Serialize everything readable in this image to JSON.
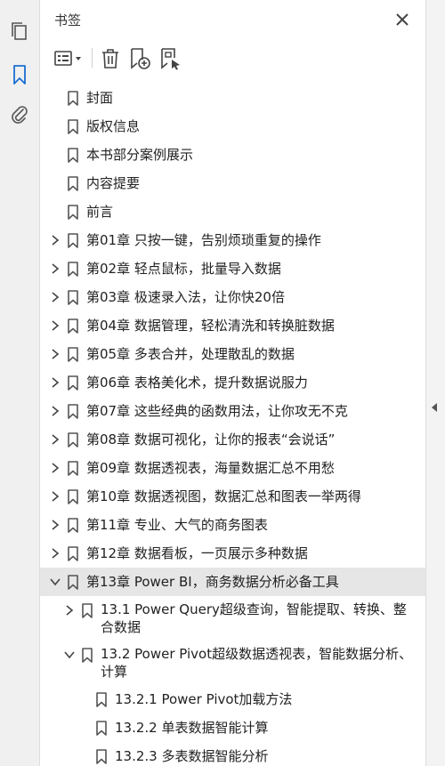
{
  "panel": {
    "title": "书签"
  },
  "colors": {
    "rail_bg": "#f0f0f0",
    "selected_bg": "#e6e6e6",
    "icon_active": "#1a6fd1",
    "icon_gray": "#555555"
  },
  "rail": {
    "icons": [
      "pages-icon",
      "bookmark-icon",
      "attachment-icon"
    ]
  },
  "toolbar": {
    "icons": [
      "options-menu-icon",
      "delete-bookmark-icon",
      "add-bookmark-icon",
      "new-bookmark-from-structure-icon"
    ]
  },
  "bookmarks": [
    {
      "label": "封面",
      "level": 0,
      "expandable": false
    },
    {
      "label": "版权信息",
      "level": 0,
      "expandable": false
    },
    {
      "label": "本书部分案例展示",
      "level": 0,
      "expandable": false
    },
    {
      "label": "内容提要",
      "level": 0,
      "expandable": false
    },
    {
      "label": "前言",
      "level": 0,
      "expandable": false
    },
    {
      "label": "第01章 只按一键，告别烦琐重复的操作",
      "level": 0,
      "expandable": true,
      "expanded": false
    },
    {
      "label": "第02章 轻点鼠标，批量导入数据",
      "level": 0,
      "expandable": true,
      "expanded": false
    },
    {
      "label": "第03章 极速录入法，让你快20倍",
      "level": 0,
      "expandable": true,
      "expanded": false
    },
    {
      "label": "第04章 数据管理，轻松清洗和转换脏数据",
      "level": 0,
      "expandable": true,
      "expanded": false
    },
    {
      "label": "第05章 多表合并，处理散乱的数据",
      "level": 0,
      "expandable": true,
      "expanded": false
    },
    {
      "label": "第06章 表格美化术，提升数据说服力",
      "level": 0,
      "expandable": true,
      "expanded": false
    },
    {
      "label": "第07章 这些经典的函数用法，让你攻无不克",
      "level": 0,
      "expandable": true,
      "expanded": false
    },
    {
      "label": "第08章 数据可视化，让你的报表“会说话”",
      "level": 0,
      "expandable": true,
      "expanded": false
    },
    {
      "label": "第09章 数据透视表，海量数据汇总不用愁",
      "level": 0,
      "expandable": true,
      "expanded": false
    },
    {
      "label": "第10章 数据透视图，数据汇总和图表一举两得",
      "level": 0,
      "expandable": true,
      "expanded": false
    },
    {
      "label": "第11章 专业、大气的商务图表",
      "level": 0,
      "expandable": true,
      "expanded": false
    },
    {
      "label": "第12章 数据看板，一页展示多种数据",
      "level": 0,
      "expandable": true,
      "expanded": false
    },
    {
      "label": "第13章 Power BI，商务数据分析必备工具",
      "level": 0,
      "expandable": true,
      "expanded": true,
      "selected": true
    },
    {
      "label": "13.1 Power Query超级查询，智能提取、转换、整合数据",
      "level": 1,
      "expandable": true,
      "expanded": false
    },
    {
      "label": "13.2 Power Pivot超级数据透视表，智能数据分析、计算",
      "level": 1,
      "expandable": true,
      "expanded": true
    },
    {
      "label": "13.2.1 Power Pivot加载方法",
      "level": 2,
      "expandable": false
    },
    {
      "label": "13.2.2 单表数据智能计算",
      "level": 2,
      "expandable": false
    },
    {
      "label": "13.2.3 多表数据智能分析",
      "level": 2,
      "expandable": false
    }
  ]
}
